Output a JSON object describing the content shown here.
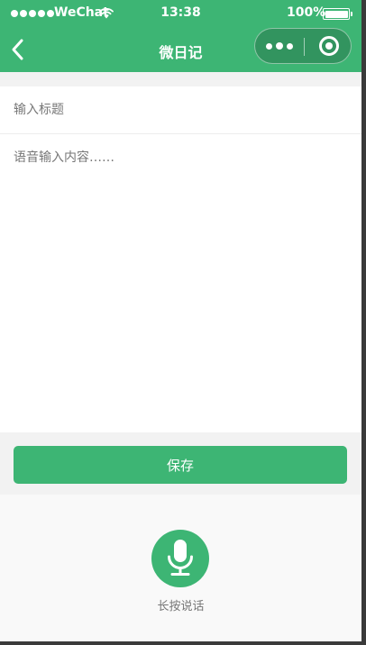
{
  "status_bar": {
    "carrier": "WeChat",
    "time": "13:38",
    "battery": "100%"
  },
  "nav": {
    "title": "微日记"
  },
  "form": {
    "title_placeholder": "输入标题",
    "content_placeholder": "语音输入内容……"
  },
  "actions": {
    "save_label": "保存"
  },
  "voice": {
    "hint": "长按说话"
  },
  "colors": {
    "accent": "#3db574",
    "page_bg": "#f2f2f2",
    "panel_bg": "#f9f9f9"
  },
  "icons": {
    "back": "chevron-left-icon",
    "more": "more-dots-icon",
    "close": "target-close-icon",
    "mic": "microphone-icon",
    "wifi": "wifi-icon",
    "battery": "battery-icon"
  }
}
